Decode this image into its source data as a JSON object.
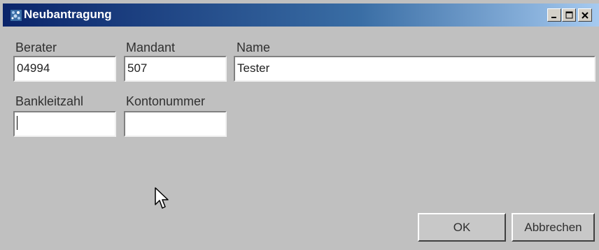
{
  "window": {
    "title": "Neubantragung"
  },
  "fields": {
    "berater": {
      "label": "Berater",
      "value": "04994"
    },
    "mandant": {
      "label": "Mandant",
      "value": "507"
    },
    "name": {
      "label": "Name",
      "value": "Tester"
    },
    "bankleitzahl": {
      "label": "Bankleitzahl",
      "value": ""
    },
    "kontonummer": {
      "label": "Kontonummer",
      "value": ""
    }
  },
  "buttons": {
    "ok": "OK",
    "cancel": "Abbrechen"
  },
  "icons": {
    "app": "app-icon",
    "minimize": "minimize-icon",
    "maximize": "maximize-icon",
    "close": "close-icon",
    "cursor": "mouse-pointer-icon"
  }
}
